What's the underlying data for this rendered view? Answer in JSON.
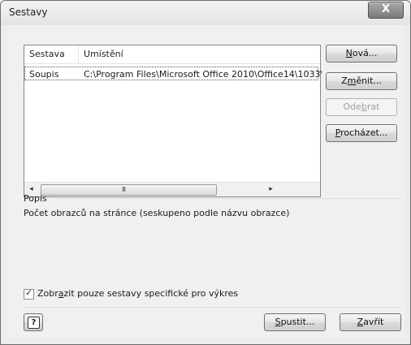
{
  "window": {
    "title": "Sestavy",
    "close_glyph": "X"
  },
  "list": {
    "columns": [
      "Sestava",
      "Umístění"
    ],
    "rows": [
      {
        "name": "Soupis",
        "location": "C:\\Program Files\\Microsoft Office 2010\\Office14\\1033\\"
      }
    ],
    "scroll_left": "◂",
    "scroll_right": "▸",
    "scroll_grip": "III"
  },
  "buttons": {
    "new": {
      "pre": "",
      "acc": "N",
      "post": "ová..."
    },
    "change": {
      "pre": "Z",
      "acc": "m",
      "post": "ěnit..."
    },
    "remove": {
      "pre": "Ode",
      "acc": "b",
      "post": "rat"
    },
    "browse": {
      "pre": "",
      "acc": "P",
      "post": "rocházet..."
    },
    "run": {
      "pre": "",
      "acc": "S",
      "post": "pustit..."
    },
    "close": {
      "pre": "",
      "acc": "Z",
      "post": "avřít"
    }
  },
  "description": {
    "label": "Popis",
    "text": "Počet obrazců na stránce (seskupeno podle názvu obrazce)"
  },
  "filter_checkbox": {
    "checked": true,
    "pre": "Zobr",
    "acc": "a",
    "post": "zit pouze sestavy specifické pro výkres"
  },
  "help_glyph": "?"
}
